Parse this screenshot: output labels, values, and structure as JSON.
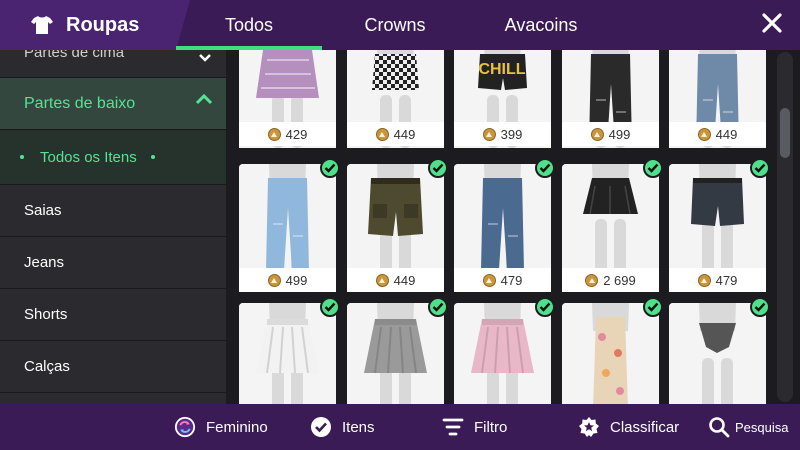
{
  "header": {
    "title": "Roupas",
    "tabs": [
      {
        "label": "Todos",
        "active": true
      },
      {
        "label": "Crowns",
        "active": false
      },
      {
        "label": "Avacoins",
        "active": false
      }
    ]
  },
  "sidebar": {
    "top_item": "Partes de cima",
    "section": "Partes de baixo",
    "subitem": "Todos os Itens",
    "items": [
      "Saias",
      "Jeans",
      "Shorts",
      "Calças"
    ]
  },
  "products": [
    {
      "price": "429",
      "owned": false,
      "garment": "plaid-skirt",
      "color": "#b58fbe"
    },
    {
      "price": "449",
      "owned": false,
      "garment": "checker-skirt",
      "color": "#333333"
    },
    {
      "price": "399",
      "owned": false,
      "garment": "chill-shorts",
      "color": "#222222"
    },
    {
      "price": "499",
      "owned": false,
      "garment": "ripped-pants",
      "color": "#2a2a2a"
    },
    {
      "price": "449",
      "owned": false,
      "garment": "jeans",
      "color": "#6e8aa8"
    },
    {
      "price": "499",
      "owned": true,
      "garment": "light-jeans",
      "color": "#8fb8dc"
    },
    {
      "price": "449",
      "owned": true,
      "garment": "cargo-shorts",
      "color": "#4e4a30"
    },
    {
      "price": "479",
      "owned": true,
      "garment": "dark-jeans",
      "color": "#4a6a90"
    },
    {
      "price": "2 699",
      "owned": true,
      "garment": "black-mini-skirt",
      "color": "#222222"
    },
    {
      "price": "479",
      "owned": true,
      "garment": "denim-shorts",
      "color": "#333a44"
    },
    {
      "price": "",
      "owned": true,
      "garment": "white-pleated-skirt",
      "color": "#f2f2f2"
    },
    {
      "price": "",
      "owned": true,
      "garment": "gray-pleated-skirt",
      "color": "#9a9a9a"
    },
    {
      "price": "",
      "owned": true,
      "garment": "pink-pleated-skirt",
      "color": "#e9b8c8"
    },
    {
      "price": "",
      "owned": true,
      "garment": "floral-long-skirt",
      "color": "#e8d5b8"
    },
    {
      "price": "",
      "owned": true,
      "garment": "bikini-bottom",
      "color": "#555555"
    }
  ],
  "bottom": {
    "feminino": "Feminino",
    "itens": "Itens",
    "filtro": "Filtro",
    "classificar": "Classificar",
    "pesquisa": "Pesquisa"
  },
  "colors": {
    "accent": "#3ee07e",
    "header_bg": "#3a1b55",
    "brand_bg": "#4a2470",
    "sidebar_bg": "#2a2a2f",
    "coin": "#c9963d"
  },
  "icons": [
    "shirt-icon",
    "close-icon",
    "chevron-down-icon",
    "chevron-up-icon",
    "coin-icon",
    "check-icon",
    "gender-swap-icon",
    "filter-icon",
    "star-badge-icon",
    "search-icon"
  ]
}
